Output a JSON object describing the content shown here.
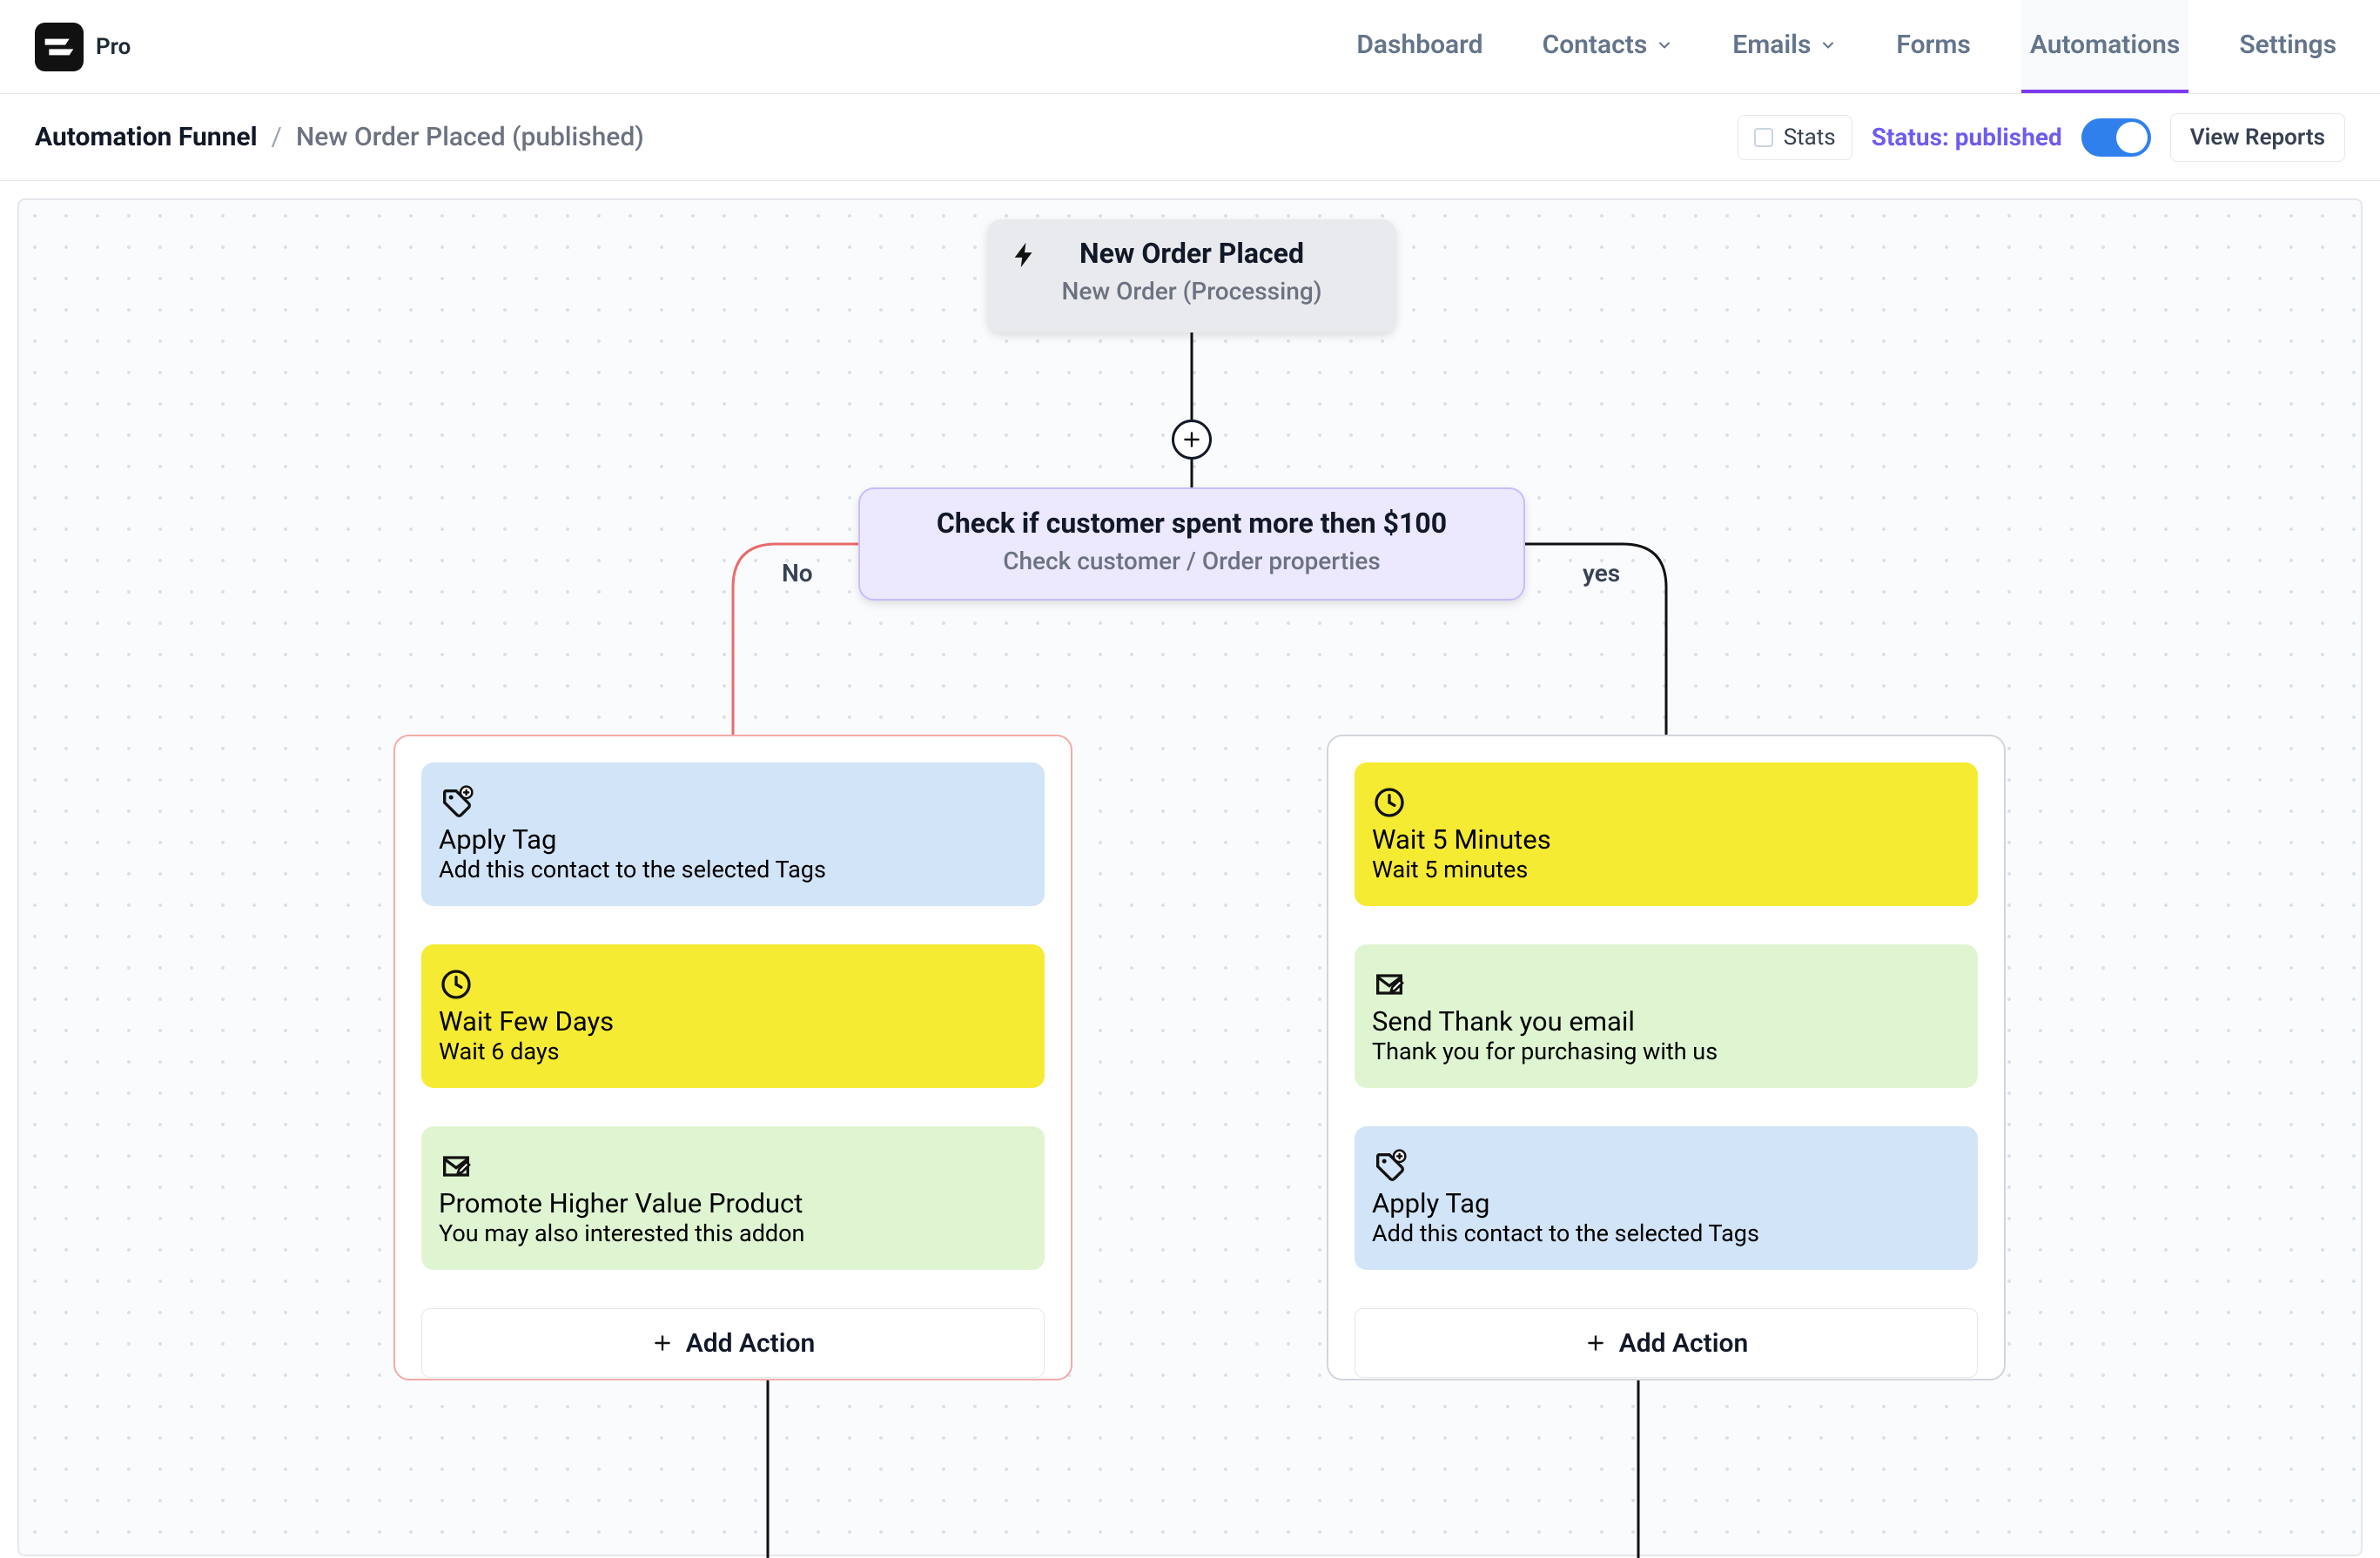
{
  "brand": {
    "label": "Pro"
  },
  "nav": {
    "dashboard": "Dashboard",
    "contacts": "Contacts",
    "emails": "Emails",
    "forms": "Forms",
    "automations": "Automations",
    "settings": "Settings"
  },
  "subbar": {
    "crumb_label": "Automation Funnel",
    "funnel_name": "New Order Placed (published)",
    "stats_label": "Stats",
    "status_label": "Status: published",
    "view_reports": "View Reports"
  },
  "trigger": {
    "title": "New Order Placed",
    "sub": "New Order (Processing)"
  },
  "condition": {
    "title": "Check if customer spent more then $100",
    "sub": "Check customer / Order properties"
  },
  "labels": {
    "no": "No",
    "yes": "yes"
  },
  "branches": {
    "no": {
      "a1": {
        "title": "Apply Tag",
        "sub": "Add this contact to the selected Tags"
      },
      "a2": {
        "title": "Wait Few Days",
        "sub": "Wait 6 days"
      },
      "a3": {
        "title": "Promote Higher Value Product",
        "sub": "You may also interested this addon"
      }
    },
    "yes": {
      "a1": {
        "title": "Wait 5 Minutes",
        "sub": "Wait 5 minutes"
      },
      "a2": {
        "title": "Send Thank you email",
        "sub": "Thank you for purchasing with us"
      },
      "a3": {
        "title": "Apply Tag",
        "sub": "Add this contact to the selected Tags"
      }
    }
  },
  "add_action": "Add Action"
}
